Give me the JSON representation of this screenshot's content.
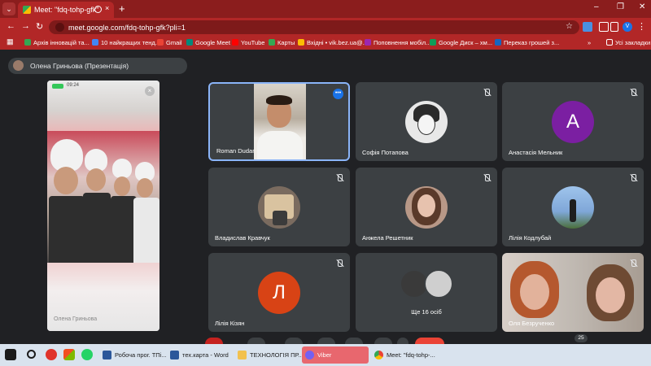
{
  "browser": {
    "tab_title": "Meet: \"fdq-tohp-gfk\"",
    "tab_close": "×",
    "new_tab": "+",
    "win_min": "–",
    "win_max": "❐",
    "win_close": "✕",
    "nav_back": "←",
    "nav_forward": "→",
    "nav_reload": "↻",
    "url": "meet.google.com/fdq-tohp-gfk?pli=1",
    "star": "☆",
    "profile_initial": "V",
    "accent_color": "#b22727"
  },
  "bookmarks": [
    {
      "label": "Архів інновацій та...",
      "icon_color": "#34a853"
    },
    {
      "label": "10 найкращих тенд...",
      "icon_color": "#4285f4"
    },
    {
      "label": "Gmail",
      "icon_color": "#ea4335"
    },
    {
      "label": "Google Meet",
      "icon_color": "#00897b"
    },
    {
      "label": "YouTube",
      "icon_color": "#ff0000"
    },
    {
      "label": "Карты",
      "icon_color": "#34a853"
    },
    {
      "label": "Вхідні • vik.bez.ua@...",
      "icon_color": "#fbbc04"
    },
    {
      "label": "Поповнення мобіл...",
      "icon_color": "#9c27b0"
    },
    {
      "label": "Google Диск – хм...",
      "icon_color": "#0f9d58"
    },
    {
      "label": "Переказ грошей з...",
      "icon_color": "#1565c0"
    }
  ],
  "bookmarks_more": "»",
  "bookmarks_all": "Усі закладки",
  "meet": {
    "presenter_label": "Олена Гриньова (Презентація)",
    "phone_time": "09:24",
    "phone_caption": "Олена Гриньова",
    "phone_close": "×",
    "participants": [
      {
        "name": "Roman Dudar",
        "type": "video",
        "active": true
      },
      {
        "name": "Софія Потапова",
        "type": "avatar-image",
        "color": "#e8e8e8"
      },
      {
        "name": "Анастасія Мельник",
        "type": "letter",
        "letter": "A",
        "color": "#7b1fa2"
      },
      {
        "name": "Владислав Кравчук",
        "type": "avatar-image",
        "color": "#7a6b5f"
      },
      {
        "name": "Анжела Решетник",
        "type": "avatar-image",
        "color": "#b89887"
      },
      {
        "name": "Лілія Кодлубай",
        "type": "avatar-image",
        "color": "#7fa7d8"
      },
      {
        "name": "Лілія Кізян",
        "type": "letter",
        "letter": "Л",
        "color": "#d84315"
      },
      {
        "name": "Ще 16 осіб",
        "type": "more"
      },
      {
        "name": "Оля Безрученко",
        "type": "video"
      }
    ],
    "participant_count": "25",
    "more_options": "•••"
  },
  "taskbar": {
    "items": [
      {
        "label": "Робоча прог. ТПі...",
        "icon_color": "#2b579a"
      },
      {
        "label": "тех.карта - Word",
        "icon_color": "#2b579a"
      },
      {
        "label": "ТЕХНОЛОГІЯ ПР...",
        "icon_color": "#f2c14e"
      },
      {
        "label": "Viber",
        "icon_color": "#7360f2",
        "active": true
      },
      {
        "label": "Meet: \"fdq-tohp-...",
        "icon_color": "#4285f4"
      }
    ]
  }
}
